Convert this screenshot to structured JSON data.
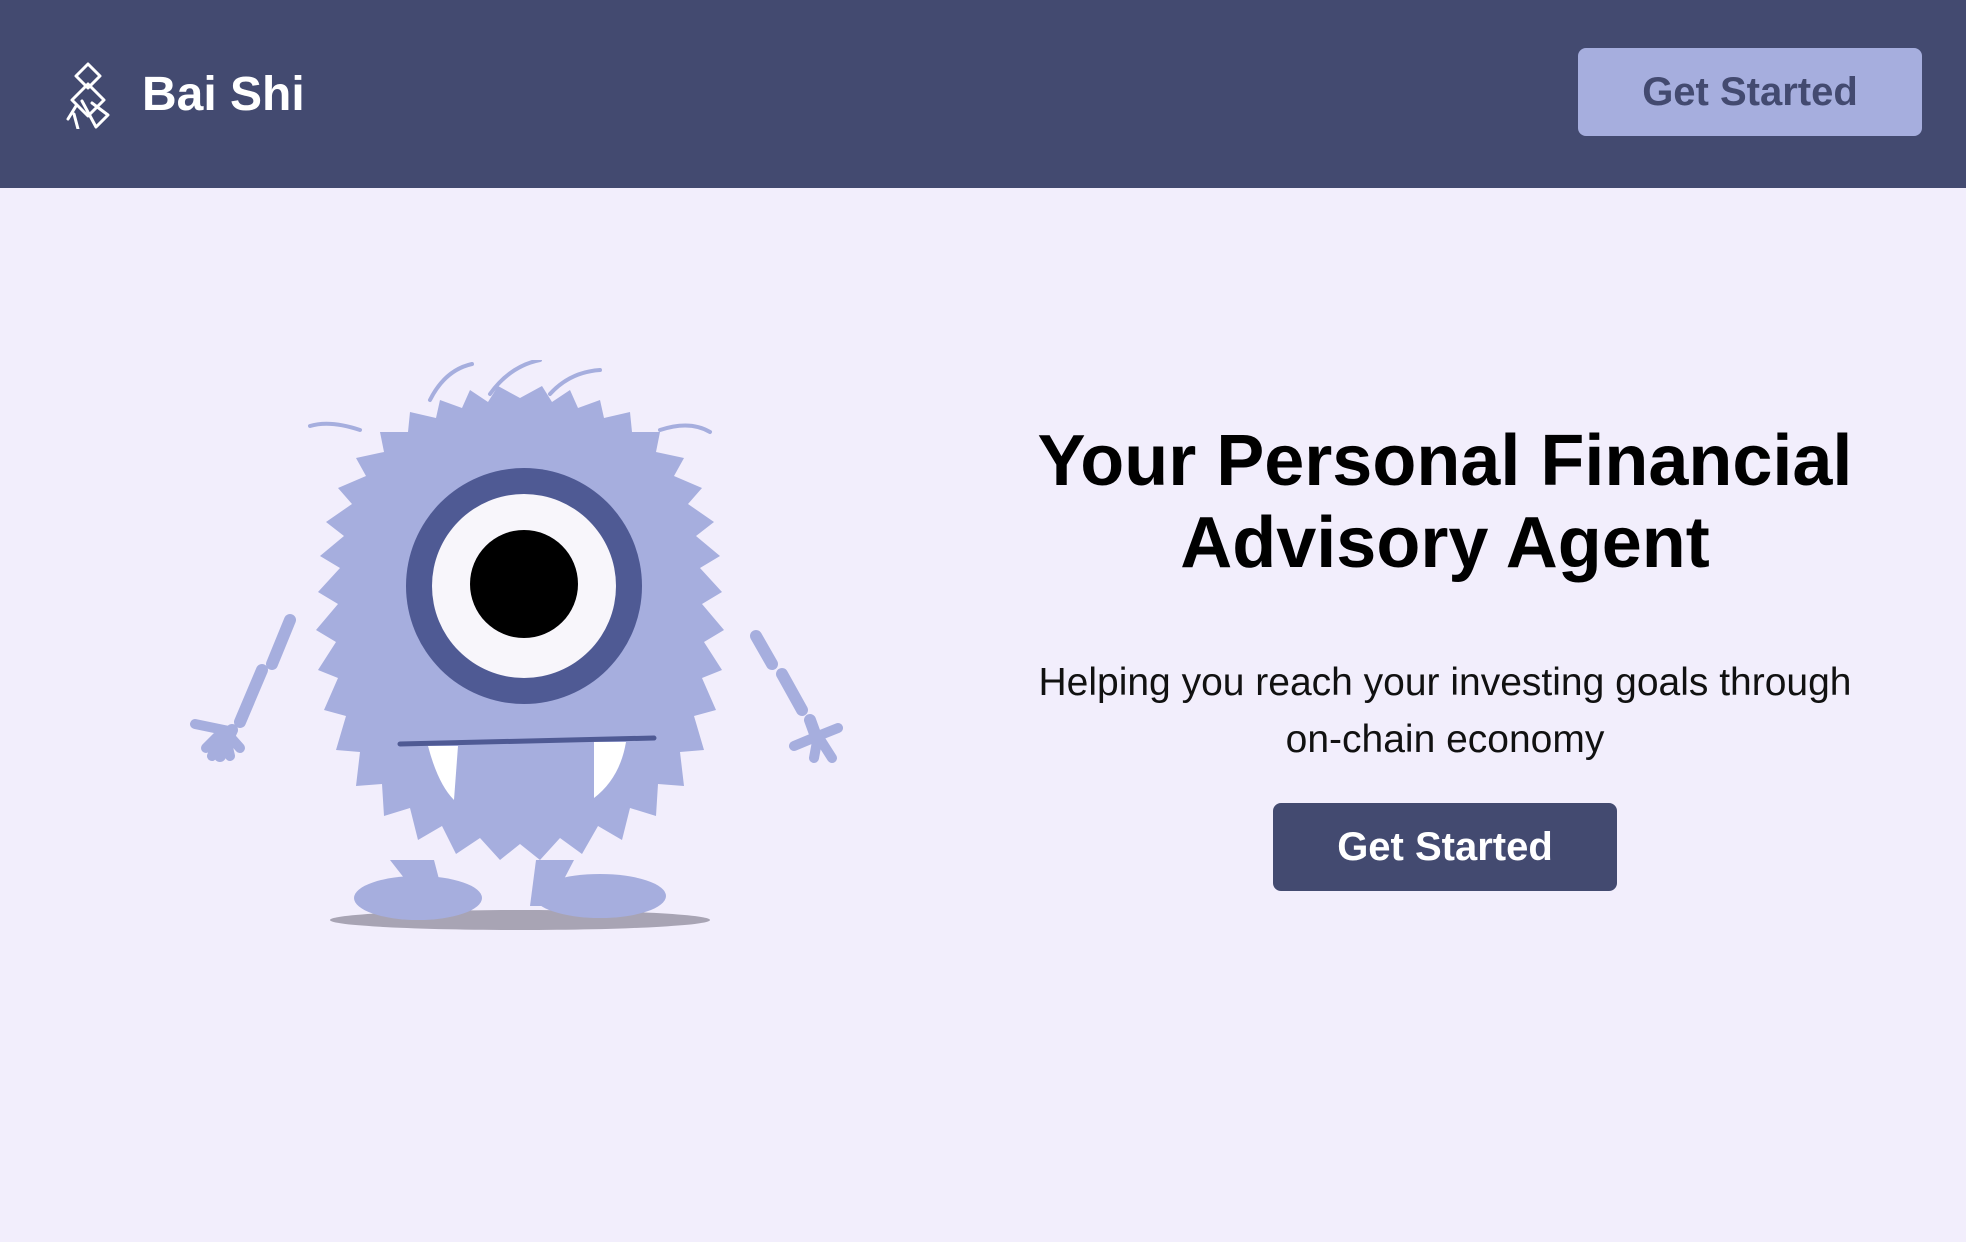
{
  "header": {
    "brand_name": "Bai Shi",
    "logo_icon": "bai-shi-logo-icon",
    "cta_label": "Get Started"
  },
  "hero": {
    "illustration": "one-eyed-monster-illustration",
    "title": "Your Personal Financial Advisory Agent",
    "subtitle": "Helping you reach your investing goals through on-chain economy",
    "cta_label": "Get Started"
  },
  "colors": {
    "header_bg": "#434a70",
    "page_bg": "#f2eefc",
    "header_button_bg": "#a6aede",
    "hero_button_bg": "#434a70",
    "monster_fur": "#a6aede",
    "monster_eye_ring": "#4f5a94"
  }
}
